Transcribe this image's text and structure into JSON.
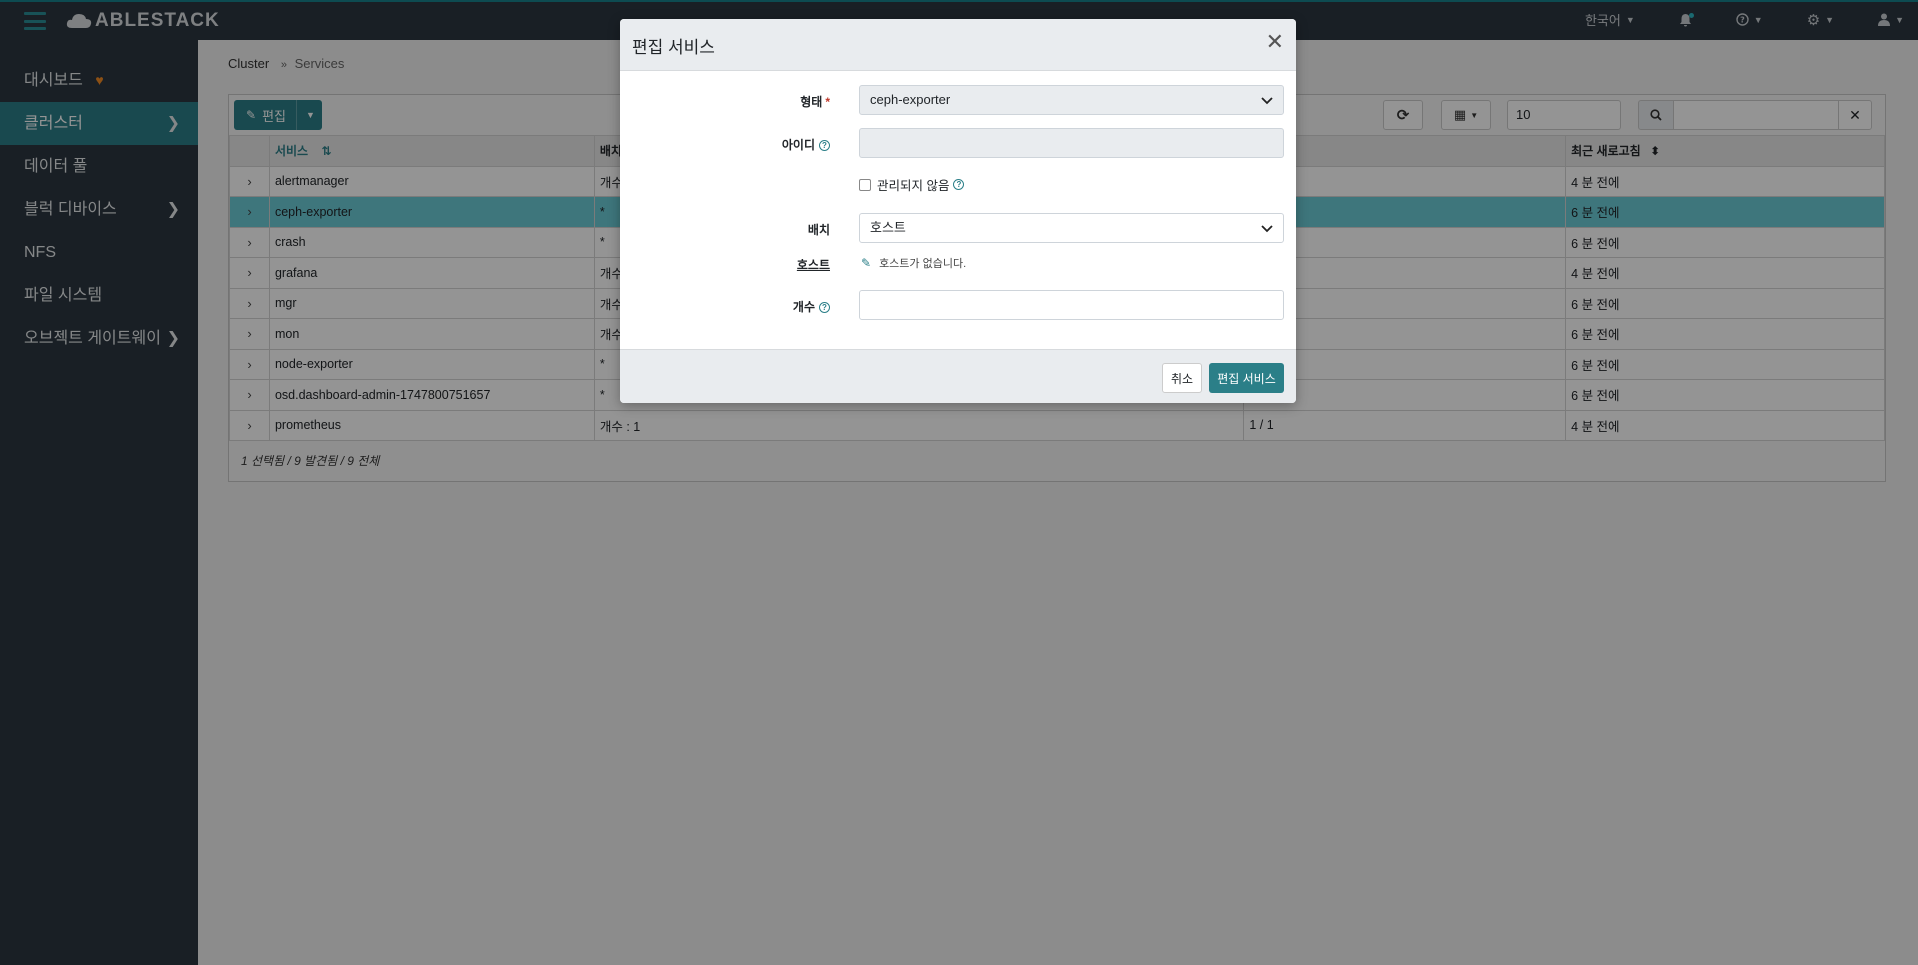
{
  "app": {
    "brand": "ABLESTACK"
  },
  "navbar": {
    "language": "한국어",
    "icons": [
      "bell-icon",
      "help-icon",
      "gear-icon",
      "user-icon"
    ]
  },
  "sidebar": {
    "items": [
      {
        "label": "대시보드",
        "has_heart": true,
        "has_chevron": false,
        "active": false
      },
      {
        "label": "클러스터",
        "has_chevron": true,
        "active": true
      },
      {
        "label": "데이터 풀",
        "has_chevron": false,
        "active": false
      },
      {
        "label": "블럭 디바이스",
        "has_chevron": true,
        "active": false
      },
      {
        "label": "NFS",
        "has_chevron": false,
        "active": false
      },
      {
        "label": "파일 시스템",
        "has_chevron": false,
        "active": false
      },
      {
        "label": "오브젝트 게이트웨이",
        "has_chevron": true,
        "active": false
      }
    ]
  },
  "breadcrumb": {
    "parent": "Cluster",
    "current": "Services"
  },
  "toolbar": {
    "edit_label": "편집",
    "page_size": "10"
  },
  "table": {
    "columns": [
      "서비스",
      "배치",
      "",
      "최근 새로고침"
    ],
    "rows": [
      {
        "service": "alertmanager",
        "placement": "개수",
        "running": "",
        "refreshed": "4 분 전에",
        "selected": false
      },
      {
        "service": "ceph-exporter",
        "placement": "*",
        "running": "",
        "refreshed": "6 분 전에",
        "selected": true
      },
      {
        "service": "crash",
        "placement": "*",
        "running": "",
        "refreshed": "6 분 전에",
        "selected": false
      },
      {
        "service": "grafana",
        "placement": "개수",
        "running": "",
        "refreshed": "4 분 전에",
        "selected": false
      },
      {
        "service": "mgr",
        "placement": "개수",
        "running": "",
        "refreshed": "6 분 전에",
        "selected": false
      },
      {
        "service": "mon",
        "placement": "개수",
        "running": "",
        "refreshed": "6 분 전에",
        "selected": false
      },
      {
        "service": "node-exporter",
        "placement": "*",
        "running": "",
        "refreshed": "6 분 전에",
        "selected": false
      },
      {
        "service": "osd.dashboard-admin-1747800751657",
        "placement": "*",
        "running": "",
        "refreshed": "6 분 전에",
        "selected": false
      },
      {
        "service": "prometheus",
        "placement": "개수 : 1",
        "running": "1 / 1",
        "refreshed": "4 분 전에",
        "selected": false
      }
    ],
    "footer": "1 선택됨 / 9 발견됨 / 9 전체"
  },
  "modal": {
    "title": "편집 서비스",
    "type_label": "형태",
    "type_value": "ceph-exporter",
    "id_label": "아이디",
    "id_value": "",
    "unmanaged_label": "관리되지 않음",
    "placement_label": "배치",
    "placement_value": "호스트",
    "hosts_label": "호스트",
    "hosts_value": "호스트가 없습니다.",
    "count_label": "개수",
    "count_value": "",
    "cancel_label": "취소",
    "submit_label": "편집 서비스"
  },
  "colors": {
    "accent": "#2b7f88",
    "navbar_bg": "#2b3640",
    "selected_row": "#6ccbd6",
    "heart": "#f28a24"
  }
}
